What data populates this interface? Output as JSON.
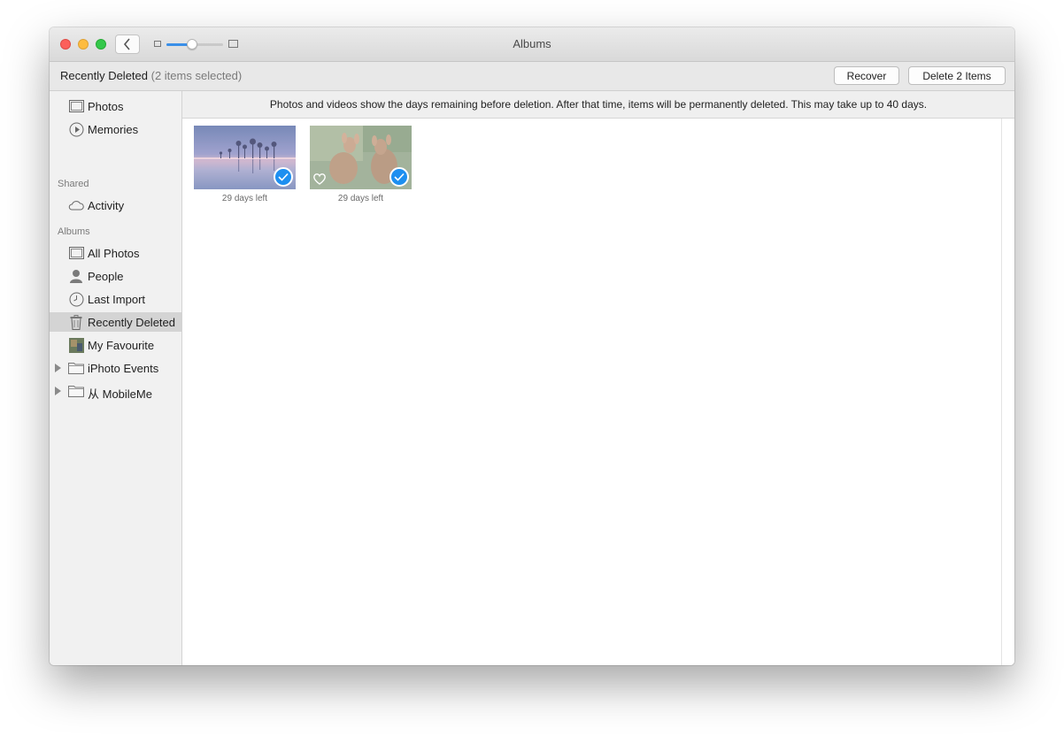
{
  "window": {
    "title": "Albums"
  },
  "titlebar": {
    "zoom_level": 0.45,
    "back_icon": "chevron-left-icon"
  },
  "toolbar": {
    "heading": "Recently Deleted",
    "selection_text": "(2 items selected)",
    "recover_label": "Recover",
    "delete_label": "Delete 2 Items"
  },
  "sidebar": {
    "top_items": [
      {
        "label": "Photos",
        "icon": "photos-icon"
      },
      {
        "label": "Memories",
        "icon": "memories-icon"
      }
    ],
    "shared_header": "Shared",
    "shared_items": [
      {
        "label": "Activity",
        "icon": "cloud-icon"
      }
    ],
    "albums_header": "Albums",
    "album_items": [
      {
        "label": "All Photos",
        "icon": "photos-icon"
      },
      {
        "label": "People",
        "icon": "person-icon"
      },
      {
        "label": "Last Import",
        "icon": "clock-icon"
      },
      {
        "label": "Recently Deleted",
        "icon": "trash-icon",
        "selected": true
      },
      {
        "label": "My Favourite",
        "icon": "album-thumbnail-icon"
      },
      {
        "label": "iPhoto Events",
        "icon": "folder-icon",
        "expandable": true
      },
      {
        "label": "从 MobileMe",
        "icon": "folder-icon",
        "expandable": true
      }
    ]
  },
  "content": {
    "banner": "Photos and videos show the days remaining before deletion. After that time, items will be permanently deleted. This may take up to 40 days.",
    "photos": [
      {
        "caption": "29 days left",
        "subject": "palm trees at dusk",
        "selected": true,
        "favorite": false
      },
      {
        "caption": "29 days left",
        "subject": "two deer",
        "selected": true,
        "favorite": true
      }
    ]
  },
  "colors": {
    "accent": "#1d8ff0",
    "close": "#fc605b",
    "minimize": "#fdbc40",
    "maximize": "#34c84a",
    "selected_row": "#d4d4d4"
  }
}
